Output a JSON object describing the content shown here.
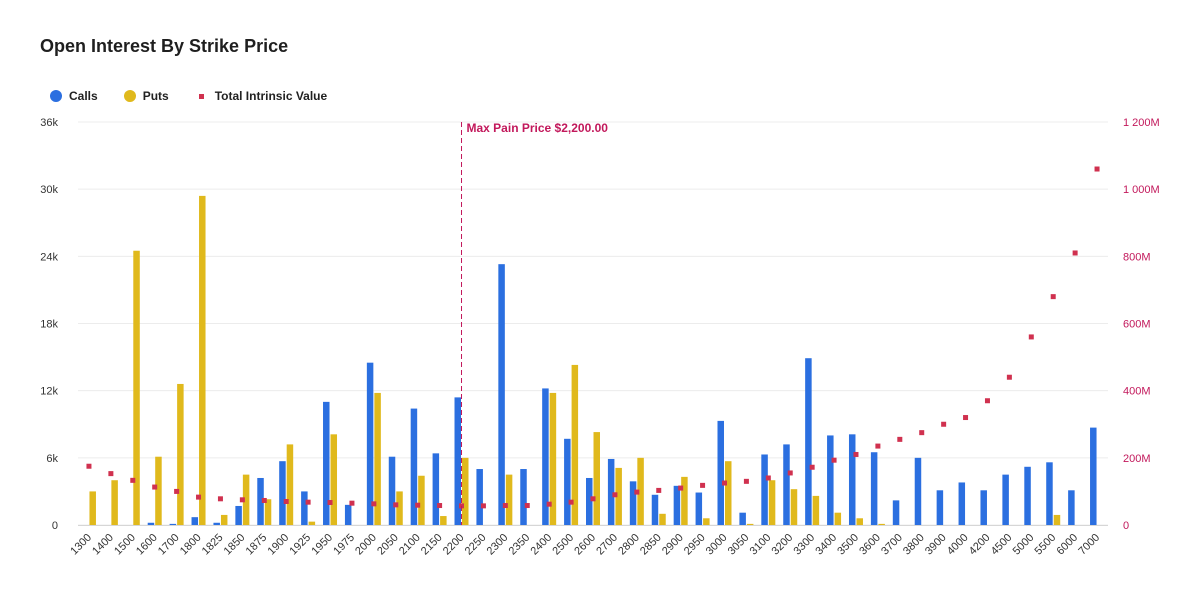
{
  "title": "Open Interest By Strike Price",
  "colors": {
    "calls": "#2b6fe0",
    "puts": "#e0b91c",
    "intrinsic": "#d0314f",
    "annotation": "#c2185b",
    "grid": "#ececec"
  },
  "chart_data": {
    "type": "bar",
    "title": "Open Interest By Strike Price",
    "categories": [
      "1300",
      "1400",
      "1500",
      "1600",
      "1700",
      "1800",
      "1825",
      "1850",
      "1875",
      "1900",
      "1925",
      "1950",
      "1975",
      "2000",
      "2050",
      "2100",
      "2150",
      "2200",
      "2250",
      "2300",
      "2350",
      "2400",
      "2500",
      "2600",
      "2700",
      "2800",
      "2850",
      "2900",
      "2950",
      "3000",
      "3050",
      "3100",
      "3200",
      "3300",
      "3400",
      "3500",
      "3600",
      "3700",
      "3800",
      "3900",
      "4000",
      "4200",
      "4500",
      "5000",
      "5500",
      "6000",
      "7000"
    ],
    "series": [
      {
        "name": "Calls",
        "type": "bar",
        "axis": "left",
        "values": [
          0,
          0,
          0,
          200,
          100,
          700,
          200,
          1700,
          4200,
          5700,
          3000,
          11000,
          1800,
          14500,
          6100,
          10400,
          6400,
          11400,
          5000,
          23300,
          5000,
          12200,
          7700,
          4200,
          5900,
          3900,
          2700,
          3500,
          2900,
          9300,
          1100,
          6300,
          7200,
          14900,
          8000,
          8100,
          6500,
          2200,
          6000,
          3100,
          3800,
          3100,
          4500,
          5200,
          5600,
          3100,
          8700
        ]
      },
      {
        "name": "Puts",
        "type": "bar",
        "axis": "left",
        "values": [
          3000,
          4000,
          24500,
          6100,
          12600,
          29400,
          900,
          4500,
          2300,
          7200,
          300,
          8100,
          0,
          11800,
          3000,
          4400,
          800,
          6000,
          0,
          4500,
          0,
          11800,
          14300,
          8300,
          5100,
          6000,
          1000,
          4300,
          600,
          5700,
          100,
          4000,
          3200,
          2600,
          1100,
          600,
          100,
          0,
          0,
          0,
          0,
          0,
          0,
          0,
          900,
          0,
          0
        ]
      },
      {
        "name": "Total Intrinsic Value",
        "type": "scatter",
        "axis": "right",
        "unit": "M",
        "values": [
          175,
          153,
          133,
          113,
          100,
          83,
          78,
          75,
          73,
          70,
          68,
          67,
          65,
          63,
          60,
          59,
          58,
          57,
          57,
          58,
          58,
          62,
          68,
          78,
          90,
          98,
          103,
          110,
          118,
          125,
          130,
          140,
          155,
          172,
          193,
          210,
          235,
          255,
          275,
          300,
          320,
          370,
          440,
          560,
          680,
          810,
          1060
        ]
      }
    ],
    "y_left": {
      "min": 0,
      "max": 36000,
      "ticks": [
        0,
        6000,
        12000,
        18000,
        24000,
        30000,
        36000
      ],
      "tick_labels": [
        "0",
        "6k",
        "12k",
        "18k",
        "24k",
        "30k",
        "36k"
      ]
    },
    "y_right": {
      "min": 0,
      "max": 1200,
      "ticks": [
        0,
        200,
        400,
        600,
        800,
        1000,
        1200
      ],
      "tick_labels": [
        "0",
        "200M",
        "400M",
        "600M",
        "800M",
        "1 000M",
        "1 200M"
      ]
    },
    "annotation": {
      "category": "2200",
      "label": "Max Pain Price $2,200.00"
    },
    "legend": "top-left",
    "grid": true
  }
}
